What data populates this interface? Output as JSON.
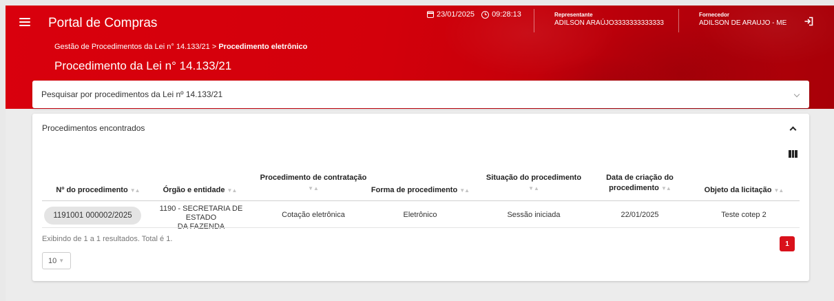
{
  "header": {
    "app_title": "Portal de Compras",
    "breadcrumb_parent": "Gestão de Procedimentos da Lei n° 14.133/21",
    "breadcrumb_separator": ">",
    "breadcrumb_current": "Procedimento eletrônico",
    "page_title": "Procedimento da Lei n° 14.133/21",
    "date": "23/01/2025",
    "time": "09:28:13",
    "representative_label": "Representante",
    "representative_value": "ADILSON ARAÚJO3333333333333",
    "supplier_label": "Fornecedor",
    "supplier_value": "ADILSON DE ARAUJO - ME",
    "icons": [
      "menu-icon",
      "calendar-icon",
      "clock-icon",
      "logout-icon"
    ]
  },
  "search_panel": {
    "label": "Pesquisar por procedimentos da Lei nº 14.133/21"
  },
  "results_panel": {
    "title": "Procedimentos encontrados",
    "columns": [
      "Nº do procedimento",
      "Órgão e entidade",
      "Procedimento de contratação",
      "Forma de procedimento",
      "Situação do procedimento",
      "Data de criação do procedimento",
      "Objeto da licitação"
    ],
    "rows": [
      {
        "numero": "1191001 000002/2025",
        "orgao_line1": "1190 - SECRETARIA DE ESTADO",
        "orgao_line2": "DA FAZENDA",
        "contratacao": "Cotação eletrônica",
        "forma": "Eletrônico",
        "situacao": "Sessão iniciada",
        "data": "22/01/2025",
        "objeto": "Teste cotep 2"
      }
    ],
    "footer_info": "Exibindo de 1 a 1 resultados. Total é 1.",
    "page_size": "10",
    "current_page": "1"
  },
  "colors": {
    "brand_red": "#d9000d",
    "page_button": "#d9111b"
  }
}
